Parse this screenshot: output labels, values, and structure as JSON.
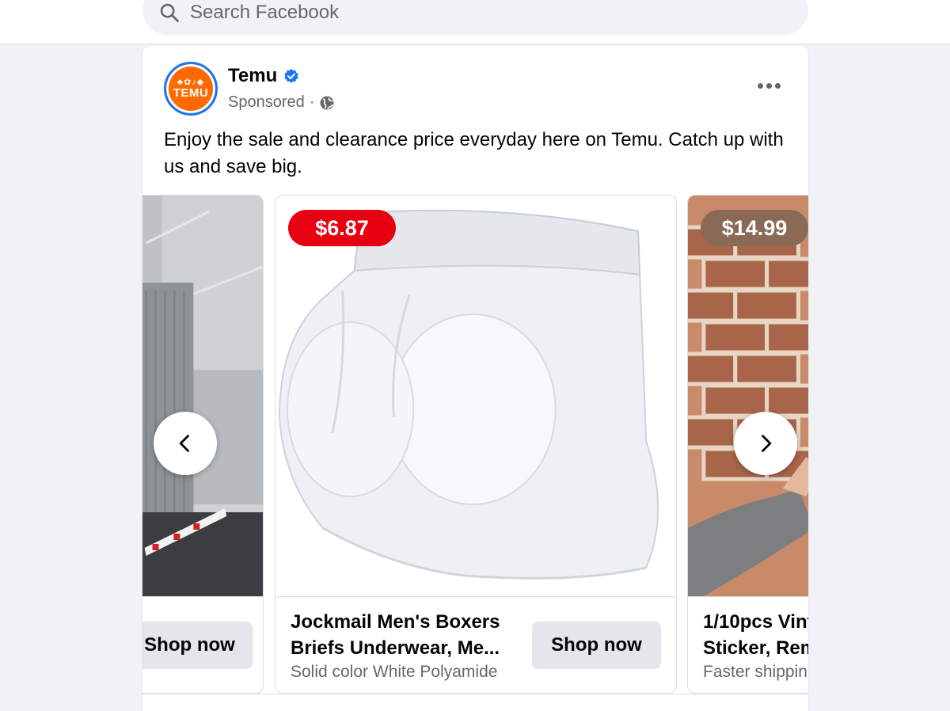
{
  "search": {
    "placeholder": "Search Facebook"
  },
  "post": {
    "page_name": "Temu",
    "avatar_logo_text": "TEMU",
    "avatar_logo_glyphs": "♣✿♪◆",
    "sponsored_label": "Sponsored",
    "meta_separator": "·",
    "caption": "Enjoy the sale and clearance price everyday here on Temu. Catch up with us and save big.",
    "icons": {
      "search": "search-icon",
      "verified": "verified-badge-icon",
      "globe": "globe-icon",
      "more": "more-options-icon",
      "prev": "chevron-left-icon",
      "next": "chevron-right-icon"
    }
  },
  "carousel": {
    "items": [
      {
        "title_line1": "",
        "title_line2": "",
        "subtitle": "",
        "price": "",
        "button_label": "Shop now"
      },
      {
        "title_line1": "Jockmail Men's Boxers",
        "title_line2": "Briefs Underwear, Me...",
        "subtitle": "Solid color White Polyamide",
        "price": "$6.87",
        "button_label": "Shop now"
      },
      {
        "title_line1": "1/10pcs Vint",
        "title_line2": "Sticker, Rem",
        "subtitle": "Faster shippin",
        "price": "$14.99",
        "button_label": ""
      }
    ]
  },
  "colors": {
    "brand_blue": "#1877f2",
    "temu_orange": "#ff6a00",
    "price_red": "#e60012",
    "price_brown": "#8b6a55",
    "button_gray": "#e4e6eb",
    "secondary_text": "#65676b"
  }
}
